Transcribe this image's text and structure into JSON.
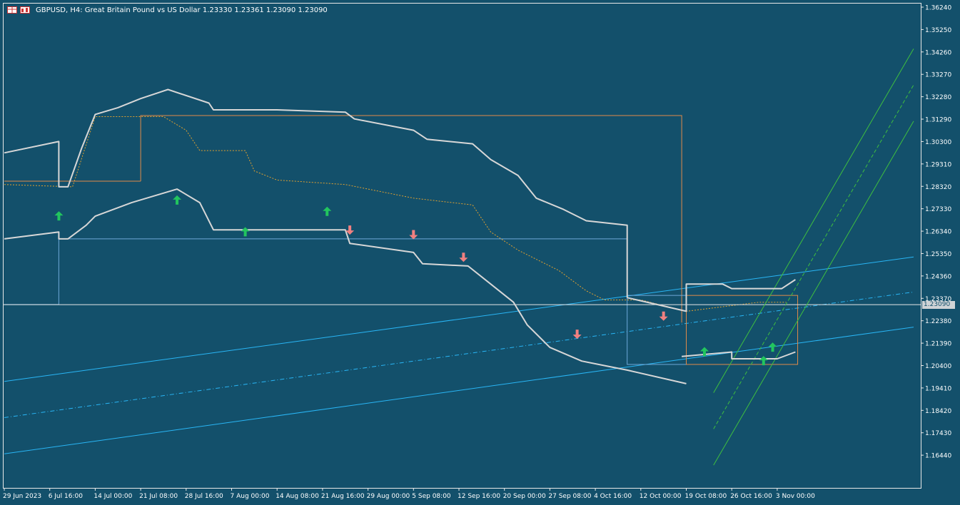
{
  "header": {
    "symbol_line": "GBPUSD, H4:  Great Britain Pound vs US Dollar  1.23330 1.23361 1.23090 1.23090",
    "icons": [
      "chart-window-icon",
      "buy-sell-icon"
    ]
  },
  "current_price": {
    "label": "1.23090",
    "value": 1.2309
  },
  "colors": {
    "background": "#13506b",
    "price_line": "#c8c8c8",
    "envelope": "#d7d7d7",
    "regression_channel": "#29b6f6",
    "donchian_box": "#e08a4a",
    "sr_line": "#6ea8d8",
    "up_arrow": "#22c55e",
    "down_arrow": "#f08080",
    "trend_channel": "#3fbf3f",
    "midline_dotted": "#e0a030"
  },
  "chart_data": {
    "type": "line",
    "title": "GBPUSD, H4",
    "ylim": [
      1.1594,
      1.3624
    ],
    "y_ticks": [
      "1.36240",
      "1.35250",
      "1.34260",
      "1.33270",
      "1.32280",
      "1.31290",
      "1.30300",
      "1.29310",
      "1.28320",
      "1.27330",
      "1.26340",
      "1.25350",
      "1.24360",
      "1.23370",
      "1.22380",
      "1.21390",
      "1.20400",
      "1.19410",
      "1.18420",
      "1.17430",
      "1.16440"
    ],
    "x_ticks": [
      "29 Jun 2023",
      "6 Jul 16:00",
      "14 Jul 00:00",
      "21 Jul 08:00",
      "28 Jul 16:00",
      "7 Aug 00:00",
      "14 Aug 08:00",
      "21 Aug 16:00",
      "29 Aug 00:00",
      "5 Sep 08:00",
      "12 Sep 16:00",
      "20 Sep 00:00",
      "27 Sep 08:00",
      "4 Oct 16:00",
      "12 Oct 00:00",
      "19 Oct 08:00",
      "26 Oct 16:00",
      "3 Nov 00:00"
    ],
    "x_tick_index": [
      0,
      1,
      2,
      3,
      4,
      5,
      6,
      7,
      8,
      9,
      10,
      11,
      12,
      13,
      14,
      15,
      16,
      17
    ],
    "price": [
      {
        "x": 0.0,
        "y": 1.266
      },
      {
        "x": 0.3,
        "y": 1.27
      },
      {
        "x": 0.6,
        "y": 1.275
      },
      {
        "x": 0.9,
        "y": 1.272
      },
      {
        "x": 1.1,
        "y": 1.276
      },
      {
        "x": 1.3,
        "y": 1.282
      },
      {
        "x": 1.6,
        "y": 1.292
      },
      {
        "x": 1.9,
        "y": 1.305
      },
      {
        "x": 2.1,
        "y": 1.312
      },
      {
        "x": 2.3,
        "y": 1.308
      },
      {
        "x": 2.6,
        "y": 1.3
      },
      {
        "x": 2.8,
        "y": 1.292
      },
      {
        "x": 3.0,
        "y": 1.285
      },
      {
        "x": 3.3,
        "y": 1.28
      },
      {
        "x": 3.6,
        "y": 1.292
      },
      {
        "x": 3.9,
        "y": 1.28
      },
      {
        "x": 4.2,
        "y": 1.276
      },
      {
        "x": 4.6,
        "y": 1.27
      },
      {
        "x": 5.0,
        "y": 1.272
      },
      {
        "x": 5.4,
        "y": 1.277
      },
      {
        "x": 5.8,
        "y": 1.271
      },
      {
        "x": 6.2,
        "y": 1.275
      },
      {
        "x": 6.6,
        "y": 1.272
      },
      {
        "x": 7.0,
        "y": 1.276
      },
      {
        "x": 7.4,
        "y": 1.27
      },
      {
        "x": 7.8,
        "y": 1.262
      },
      {
        "x": 8.1,
        "y": 1.264
      },
      {
        "x": 8.4,
        "y": 1.274
      },
      {
        "x": 8.7,
        "y": 1.265
      },
      {
        "x": 9.0,
        "y": 1.262
      },
      {
        "x": 9.3,
        "y": 1.254
      },
      {
        "x": 9.7,
        "y": 1.252
      },
      {
        "x": 10.1,
        "y": 1.256
      },
      {
        "x": 10.5,
        "y": 1.247
      },
      {
        "x": 10.9,
        "y": 1.242
      },
      {
        "x": 11.2,
        "y": 1.24
      },
      {
        "x": 11.4,
        "y": 1.228
      },
      {
        "x": 11.8,
        "y": 1.222
      },
      {
        "x": 12.1,
        "y": 1.216
      },
      {
        "x": 12.4,
        "y": 1.226
      },
      {
        "x": 12.7,
        "y": 1.212
      },
      {
        "x": 12.9,
        "y": 1.206
      },
      {
        "x": 13.2,
        "y": 1.212
      },
      {
        "x": 13.5,
        "y": 1.222
      },
      {
        "x": 13.8,
        "y": 1.232
      },
      {
        "x": 14.1,
        "y": 1.23
      },
      {
        "x": 14.4,
        "y": 1.224
      },
      {
        "x": 14.7,
        "y": 1.221
      },
      {
        "x": 15.0,
        "y": 1.216
      },
      {
        "x": 15.3,
        "y": 1.219
      },
      {
        "x": 15.6,
        "y": 1.226
      },
      {
        "x": 15.8,
        "y": 1.214
      },
      {
        "x": 16.1,
        "y": 1.21
      },
      {
        "x": 16.4,
        "y": 1.213
      },
      {
        "x": 16.7,
        "y": 1.21
      },
      {
        "x": 16.9,
        "y": 1.214
      },
      {
        "x": 17.1,
        "y": 1.226
      },
      {
        "x": 17.3,
        "y": 1.238
      },
      {
        "x": 17.45,
        "y": 1.2435
      },
      {
        "x": 17.6,
        "y": 1.2309
      }
    ],
    "envelope_upper": [
      [
        0.0,
        1.298
      ],
      [
        1.2,
        1.303
      ],
      [
        1.2,
        1.283
      ],
      [
        1.4,
        1.283
      ],
      [
        1.7,
        1.3
      ],
      [
        2.0,
        1.315
      ],
      [
        2.5,
        1.318
      ],
      [
        3.0,
        1.322
      ],
      [
        3.6,
        1.326
      ],
      [
        4.5,
        1.32
      ],
      [
        4.6,
        1.317
      ],
      [
        6.0,
        1.317
      ],
      [
        7.5,
        1.316
      ],
      [
        7.7,
        1.313
      ],
      [
        9.0,
        1.308
      ],
      [
        9.3,
        1.304
      ],
      [
        10.3,
        1.302
      ],
      [
        10.7,
        1.295
      ],
      [
        11.3,
        1.288
      ],
      [
        11.7,
        1.278
      ],
      [
        12.3,
        1.273
      ],
      [
        12.8,
        1.268
      ],
      [
        13.7,
        1.266
      ],
      [
        13.7,
        1.234
      ]
    ],
    "envelope_lower": [
      [
        0.0,
        1.26
      ],
      [
        1.2,
        1.263
      ],
      [
        1.2,
        1.26
      ],
      [
        1.4,
        1.26
      ],
      [
        1.8,
        1.266
      ],
      [
        2.0,
        1.27
      ],
      [
        2.8,
        1.276
      ],
      [
        3.8,
        1.282
      ],
      [
        4.3,
        1.276
      ],
      [
        4.6,
        1.264
      ],
      [
        6.0,
        1.264
      ],
      [
        7.5,
        1.264
      ],
      [
        7.6,
        1.258
      ],
      [
        9.0,
        1.254
      ],
      [
        9.2,
        1.249
      ],
      [
        10.2,
        1.248
      ],
      [
        10.7,
        1.24
      ],
      [
        11.2,
        1.232
      ],
      [
        11.5,
        1.222
      ],
      [
        12.0,
        1.212
      ],
      [
        12.7,
        1.206
      ],
      [
        13.7,
        1.202
      ],
      [
        15.0,
        1.196
      ]
    ],
    "envelope_segment_2": [
      [
        13.7,
        1.234
      ],
      [
        15.0,
        1.228
      ],
      [
        15.0,
        1.24
      ],
      [
        15.8,
        1.24
      ],
      [
        16.0,
        1.238
      ],
      [
        17.1,
        1.238
      ],
      [
        17.4,
        1.242
      ]
    ],
    "envelope_segment_3": [
      [
        14.9,
        1.208
      ],
      [
        16.0,
        1.21
      ],
      [
        16.0,
        1.207
      ],
      [
        17.0,
        1.207
      ],
      [
        17.4,
        1.21
      ]
    ],
    "regression_upper": [
      [
        0.0,
        1.197
      ],
      [
        20.0,
        1.252
      ]
    ],
    "regression_mid": [
      [
        0.0,
        1.181
      ],
      [
        20.0,
        1.2365
      ]
    ],
    "regression_lower": [
      [
        0.0,
        1.165
      ],
      [
        20.0,
        1.221
      ]
    ],
    "sr_line": {
      "x0": 1.2,
      "x1": 13.7,
      "y": 1.26
    },
    "sr_left_step": [
      [
        0.0,
        1.231
      ],
      [
        1.2,
        1.231
      ],
      [
        1.2,
        1.26
      ]
    ],
    "donchian_box": {
      "x0": 3.0,
      "x1": 14.9,
      "y0": 1.2855,
      "y1": 1.3145
    },
    "donchian_box_left": {
      "x0": 0.0,
      "x1": 3.0,
      "y": 1.2855
    },
    "small_boxes": [
      {
        "x0": 13.7,
        "x1": 15.0,
        "y0": 1.2045,
        "y1": 1.235
      },
      {
        "x0": 15.0,
        "x1": 17.45,
        "y0": 1.2045,
        "y1": 1.235
      }
    ],
    "current_line_y": 1.2309,
    "trend_channel": {
      "x0": 15.6,
      "y0": 1.176,
      "x1": 20.0,
      "y1": 1.328,
      "offset": 0.016
    },
    "up_arrows": [
      [
        1.2,
        1.27
      ],
      [
        3.8,
        1.277
      ],
      [
        5.3,
        1.263
      ],
      [
        7.1,
        1.272
      ],
      [
        15.4,
        1.21
      ],
      [
        16.7,
        1.206
      ],
      [
        16.9,
        1.212
      ]
    ],
    "down_arrows": [
      [
        7.6,
        1.264
      ],
      [
        9.0,
        1.262
      ],
      [
        10.1,
        1.252
      ],
      [
        12.6,
        1.218
      ],
      [
        14.5,
        1.226
      ]
    ],
    "midline_dotted": [
      [
        0.0,
        1.284
      ],
      [
        1.5,
        1.283
      ],
      [
        2.0,
        1.314
      ],
      [
        3.5,
        1.314
      ],
      [
        4.0,
        1.308
      ],
      [
        4.3,
        1.299
      ],
      [
        5.3,
        1.299
      ],
      [
        5.5,
        1.29
      ],
      [
        6.0,
        1.286
      ],
      [
        7.5,
        1.284
      ],
      [
        9.0,
        1.278
      ],
      [
        10.3,
        1.275
      ],
      [
        10.7,
        1.263
      ],
      [
        11.3,
        1.255
      ],
      [
        12.2,
        1.246
      ],
      [
        12.8,
        1.237
      ],
      [
        13.2,
        1.233
      ],
      [
        14.0,
        1.233
      ],
      [
        15.0,
        1.228
      ],
      [
        15.8,
        1.23
      ],
      [
        16.6,
        1.232
      ],
      [
        17.2,
        1.232
      ]
    ],
    "grid": false,
    "legend": "none"
  }
}
